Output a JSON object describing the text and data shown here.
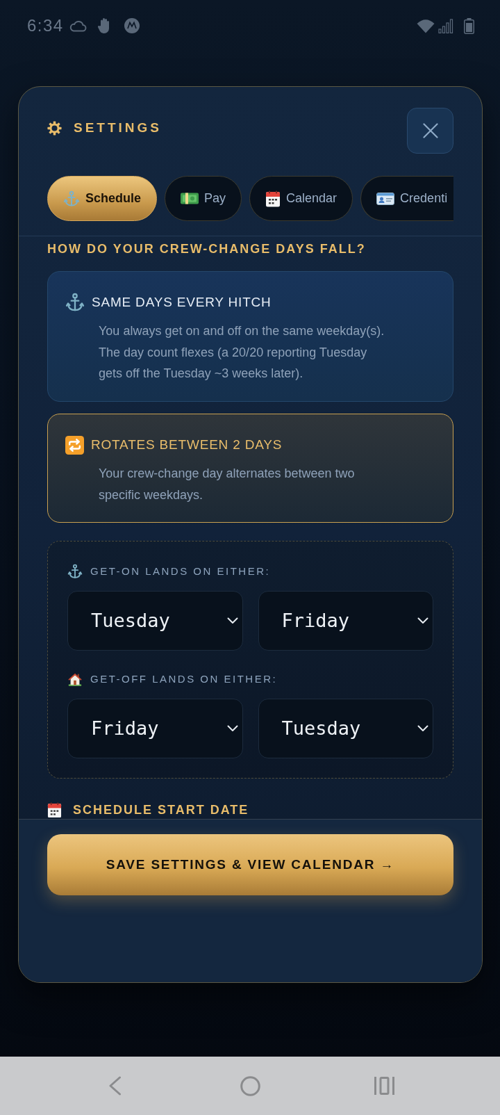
{
  "status_bar": {
    "time": "6:34"
  },
  "settings": {
    "title": "SETTINGS",
    "tabs": [
      {
        "label": "Schedule",
        "selected": true
      },
      {
        "label": "Pay",
        "selected": false
      },
      {
        "label": "Calendar",
        "selected": false
      },
      {
        "label": "Credenti",
        "selected": false
      }
    ]
  },
  "crew_change": {
    "heading": "HOW DO YOUR CREW-CHANGE DAYS FALL?",
    "options": [
      {
        "title": "SAME DAYS EVERY HITCH",
        "description": "You always get on and off on the same weekday(s). The day count flexes (a 20/20 reporting Tuesday gets off the Tuesday ~3 weeks later).",
        "selected": false
      },
      {
        "title": "ROTATES BETWEEN 2 DAYS",
        "description": "Your crew-change day alternates between two specific weekdays.",
        "selected": true
      }
    ]
  },
  "rotation": [
    {
      "label": "GET-ON LANDS ON EITHER:",
      "days": [
        "Tuesday",
        "Friday"
      ]
    },
    {
      "label": "GET-OFF LANDS ON EITHER:",
      "days": [
        "Friday",
        "Tuesday"
      ]
    }
  ],
  "start_date": {
    "label": "SCHEDULE START DATE"
  },
  "save_button": {
    "label": "SAVE SETTINGS & VIEW CALENDAR →"
  }
}
